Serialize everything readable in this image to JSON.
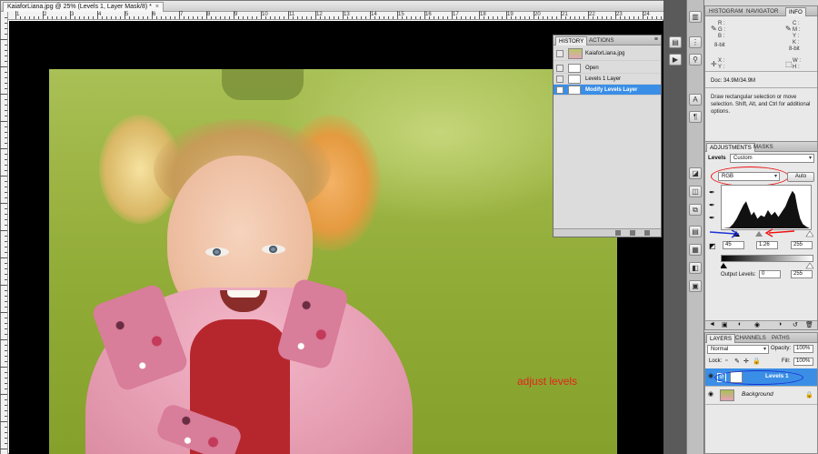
{
  "document": {
    "tab_title": "KaiaforLiana.jpg @ 25% (Levels 1, Layer Mask/8) *",
    "tab_close": "×",
    "ruler_numbers": [
      "1",
      "2",
      "3",
      "4",
      "5",
      "6",
      "7",
      "8",
      "9",
      "10",
      "11",
      "12",
      "13",
      "14",
      "15",
      "16",
      "17",
      "18",
      "19",
      "20",
      "21",
      "22",
      "23",
      "24"
    ],
    "annotation": "adjust levels",
    "annotation_color": "#e1251b"
  },
  "history_panel": {
    "tabs": [
      "HISTORY",
      "ACTIONS"
    ],
    "snapshot": "KaiaforLiana.jpg",
    "states": [
      "Open",
      "Levels 1 Layer",
      "Modify Levels Layer"
    ],
    "selected_state": "Modify Levels Layer"
  },
  "info_panel": {
    "tabs": [
      "HISTOGRAM",
      "NAVIGATOR",
      "INFO"
    ],
    "active_tab": "INFO",
    "left": {
      "r": "R :",
      "g": "G :",
      "b": "B :",
      "bit": "8-bit",
      "x": "X :",
      "y": "Y :"
    },
    "right": {
      "c": "C :",
      "m": "M :",
      "y": "Y :",
      "k": "K :",
      "bit": "8-bit",
      "w": "W :",
      "h": "H :"
    },
    "doc_size": "Doc: 34.9M/34.9M",
    "hint": "Draw rectangular selection or move selection. Shift, Alt, and Ctrl for additional options."
  },
  "adjustments_panel": {
    "tabs": [
      "ADJUSTMENTS",
      "MASKS"
    ],
    "title": "Levels",
    "preset": "Custom",
    "channel": "RGB",
    "auto_label": "Auto",
    "input_black": "45",
    "input_gamma": "1.26",
    "input_white": "255",
    "output_label": "Output Levels:",
    "output_black": "0",
    "output_white": "255"
  },
  "layers_panel": {
    "tabs": [
      "LAYERS",
      "CHANNELS",
      "PATHS"
    ],
    "blend_mode": "Normal",
    "opacity_label": "Opacity:",
    "opacity": "100%",
    "lock_label": "Lock:",
    "fill_label": "Fill:",
    "fill": "100%",
    "layers": [
      "Levels 1",
      "Background"
    ],
    "selected_layer": "Levels 1"
  },
  "colors": {
    "selection_blue": "#3a8ee6",
    "annotation_red": "#e1251b",
    "annotation_blue": "#1d32d6"
  }
}
